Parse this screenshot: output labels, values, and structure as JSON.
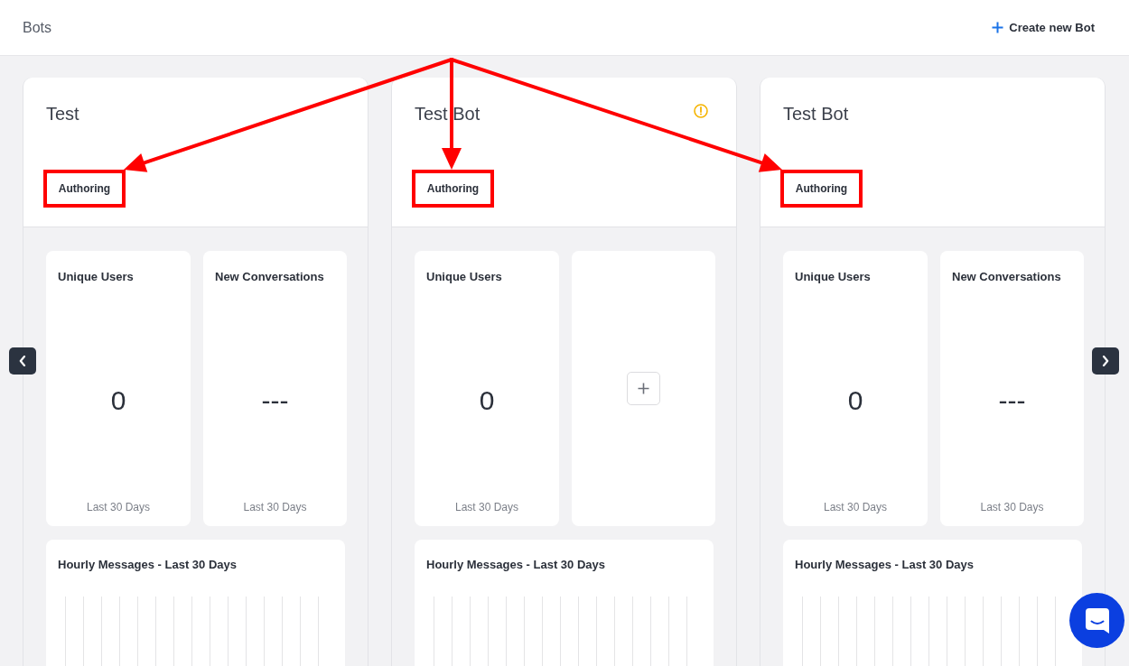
{
  "header": {
    "title": "Bots",
    "create_button": "Create new Bot"
  },
  "bots": [
    {
      "name": "Test",
      "warning": false,
      "status": {
        "label": "Authoring",
        "annotated": true
      },
      "metrics": [
        {
          "kind": "stat",
          "title": "Unique Users",
          "value": "0",
          "period": "Last 30 Days"
        },
        {
          "kind": "stat",
          "title": "New Conversations",
          "value": "---",
          "period": "Last 30 Days"
        }
      ],
      "hourly_chart": {
        "title": "Hourly Messages - Last 30 Days"
      }
    },
    {
      "name": "Test Bot",
      "warning": true,
      "status": {
        "label": "Authoring",
        "annotated": true
      },
      "metrics": [
        {
          "kind": "stat",
          "title": "Unique Users",
          "value": "0",
          "period": "Last 30 Days"
        },
        {
          "kind": "add"
        }
      ],
      "hourly_chart": {
        "title": "Hourly Messages - Last 30 Days"
      }
    },
    {
      "name": "Test Bot",
      "warning": false,
      "status": {
        "label": "Authoring",
        "annotated": true
      },
      "metrics": [
        {
          "kind": "stat",
          "title": "Unique Users",
          "value": "0",
          "period": "Last 30 Days"
        },
        {
          "kind": "stat",
          "title": "New Conversations",
          "value": "---",
          "period": "Last 30 Days"
        }
      ],
      "hourly_chart": {
        "title": "Hourly Messages - Last 30 Days"
      }
    }
  ]
}
